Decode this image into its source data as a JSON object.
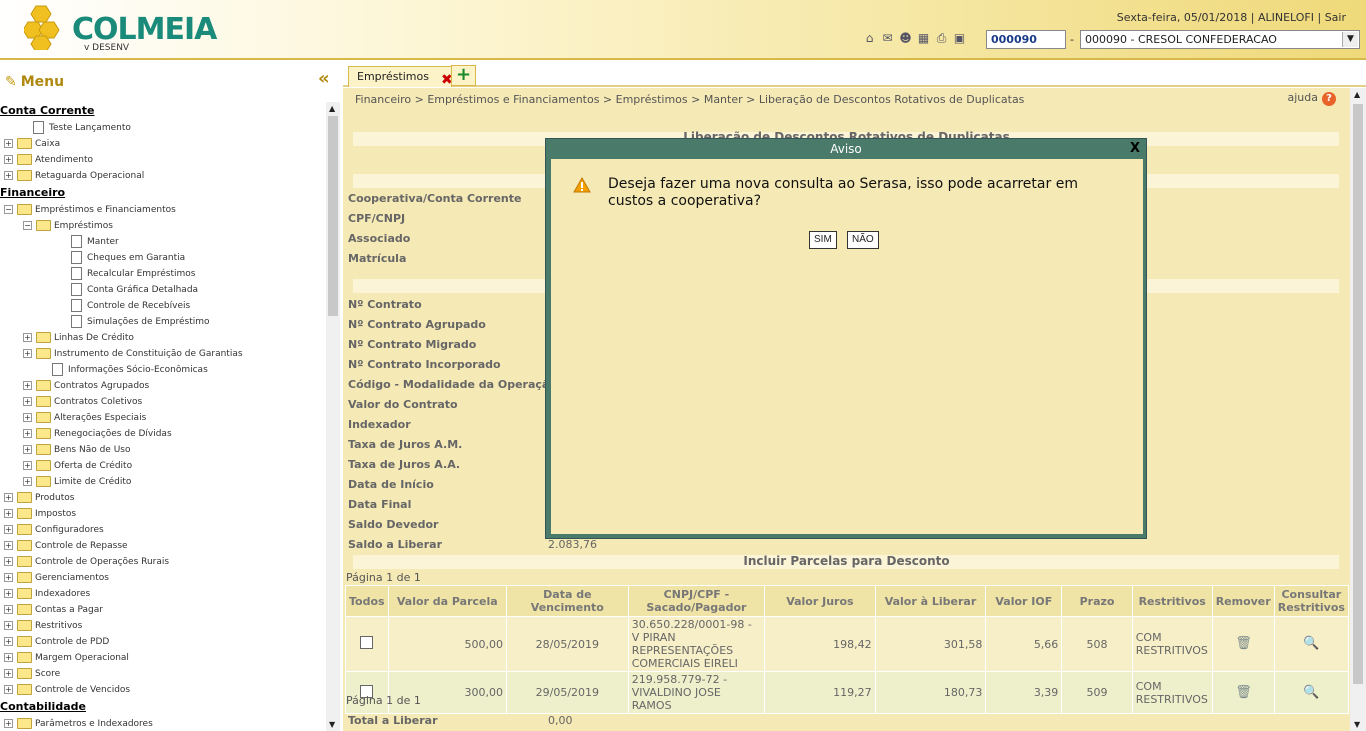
{
  "header": {
    "logo_text": "COLMEIA",
    "logo_sub": "v DESENV",
    "date": "Sexta-feira, 05/01/2018",
    "user": "ALINELOFI",
    "logout": "Sair",
    "coop_code": "000090",
    "coop_selected": "000090 - CRESOL CONFEDERACAO",
    "icons": [
      "home-icon",
      "mail-icon",
      "user-icon",
      "calculator-icon",
      "printer-icon",
      "monitor-icon"
    ]
  },
  "sidebar": {
    "title": "Menu",
    "items": [
      {
        "type": "section",
        "label": "Conta Corrente",
        "indent": 0
      },
      {
        "type": "doc",
        "label": "Teste Lançamento",
        "indent": 1
      },
      {
        "type": "folder",
        "label": "Caixa",
        "indent": 0
      },
      {
        "type": "folder",
        "label": "Atendimento",
        "indent": 0
      },
      {
        "type": "folder",
        "label": "Retaguarda Operacional",
        "indent": 0
      },
      {
        "type": "section",
        "label": "Financeiro",
        "indent": 0
      },
      {
        "type": "folder-open",
        "label": "Empréstimos e Financiamentos",
        "indent": 0
      },
      {
        "type": "folder-open",
        "label": "Empréstimos",
        "indent": 1
      },
      {
        "type": "doc",
        "label": "Manter",
        "indent": 3
      },
      {
        "type": "doc",
        "label": "Cheques em Garantia",
        "indent": 3
      },
      {
        "type": "doc",
        "label": "Recalcular Empréstimos",
        "indent": 3
      },
      {
        "type": "doc",
        "label": "Conta Gráfica Detalhada",
        "indent": 3
      },
      {
        "type": "doc",
        "label": "Controle de Recebíveis",
        "indent": 3
      },
      {
        "type": "doc",
        "label": "Simulações de Empréstimo",
        "indent": 3
      },
      {
        "type": "folder",
        "label": "Linhas De Crédito",
        "indent": 1
      },
      {
        "type": "folder",
        "label": "Instrumento de Constituição de Garantias",
        "indent": 1
      },
      {
        "type": "doc",
        "label": "Informações Sócio-Econômicas",
        "indent": 2
      },
      {
        "type": "folder",
        "label": "Contratos Agrupados",
        "indent": 1
      },
      {
        "type": "folder",
        "label": "Contratos Coletivos",
        "indent": 1
      },
      {
        "type": "folder",
        "label": "Alterações Especiais",
        "indent": 1
      },
      {
        "type": "folder",
        "label": "Renegociações de Dívidas",
        "indent": 1
      },
      {
        "type": "folder",
        "label": "Bens Não de Uso",
        "indent": 1
      },
      {
        "type": "folder",
        "label": "Oferta de Crédito",
        "indent": 1
      },
      {
        "type": "folder",
        "label": "Limite de Crédito",
        "indent": 1
      },
      {
        "type": "folder",
        "label": "Produtos",
        "indent": 0
      },
      {
        "type": "folder",
        "label": "Impostos",
        "indent": 0
      },
      {
        "type": "folder",
        "label": "Configuradores",
        "indent": 0
      },
      {
        "type": "folder",
        "label": "Controle de Repasse",
        "indent": 0
      },
      {
        "type": "folder",
        "label": "Controle de Operações Rurais",
        "indent": 0
      },
      {
        "type": "folder",
        "label": "Gerenciamentos",
        "indent": 0
      },
      {
        "type": "folder",
        "label": "Indexadores",
        "indent": 0
      },
      {
        "type": "folder",
        "label": "Contas a Pagar",
        "indent": 0
      },
      {
        "type": "folder",
        "label": "Restritivos",
        "indent": 0
      },
      {
        "type": "folder",
        "label": "Controle de PDD",
        "indent": 0
      },
      {
        "type": "folder",
        "label": "Margem Operacional",
        "indent": 0
      },
      {
        "type": "folder",
        "label": "Score",
        "indent": 0
      },
      {
        "type": "folder",
        "label": "Controle de Vencidos",
        "indent": 0
      },
      {
        "type": "section",
        "label": "Contabilidade",
        "indent": 0
      },
      {
        "type": "folder",
        "label": "Parâmetros e Indexadores",
        "indent": 0
      }
    ]
  },
  "tabs": {
    "active": "Empréstimos"
  },
  "breadcrumb": "Financeiro > Empréstimos e Financiamentos > Empréstimos > Manter > Liberação de Descontos Rotativos de Duplicatas",
  "help": "ajuda",
  "form": {
    "page_title": "Liberação de Descontos Rotativos de Duplicatas",
    "labels_top": [
      "Cooperativa/Conta Corrente",
      "CPF/CNPJ",
      "Associado",
      "Matrícula"
    ],
    "labels_contract": [
      "Nº Contrato",
      "Nº Contrato Agrupado",
      "Nº Contrato Migrado",
      "Nº Contrato Incorporado",
      "Código - Modalidade da Operação",
      "Valor do Contrato",
      "Indexador",
      "Taxa de Juros A.M.",
      "Taxa de Juros A.A.",
      "Data de Início",
      "Data Final",
      "Saldo Devedor",
      "Saldo a Liberar"
    ],
    "saldo_a_liberar": "2.083,76",
    "incluir_title": "Incluir Parcelas para Desconto",
    "pager_top": "Página 1 de 1",
    "pager_bottom": "Página 1 de 1",
    "total_label": "Total a Liberar",
    "total_value": "0,00"
  },
  "table": {
    "headers": [
      "Todos",
      "Valor da Parcela",
      "Data de Vencimento",
      "CNPJ/CPF - Sacado/Pagador",
      "Valor Juros",
      "Valor à Liberar",
      "Valor IOF",
      "Prazo",
      "Restritivos",
      "Remover",
      "Consultar Restritivos"
    ],
    "rows": [
      {
        "valor": "500,00",
        "vencimento": "28/05/2019",
        "sacado": "30.650.228/0001-98 - V PIRAN REPRESENTAÇÕES COMERCIAIS EIRELI",
        "juros": "198,42",
        "liberar": "301,58",
        "iof": "5,66",
        "prazo": "508",
        "restritivos": "COM RESTRITIVOS"
      },
      {
        "valor": "300,00",
        "vencimento": "29/05/2019",
        "sacado": "219.958.779-72 - VIVALDINO JOSE RAMOS",
        "juros": "119,27",
        "liberar": "180,73",
        "iof": "3,39",
        "prazo": "509",
        "restritivos": "COM RESTRITIVOS"
      }
    ]
  },
  "modal": {
    "title": "Aviso",
    "close": "X",
    "message": "Deseja fazer uma nova consulta ao Serasa, isso pode acarretar em custos a cooperativa?",
    "yes": "SIM",
    "no": "NÃO"
  }
}
